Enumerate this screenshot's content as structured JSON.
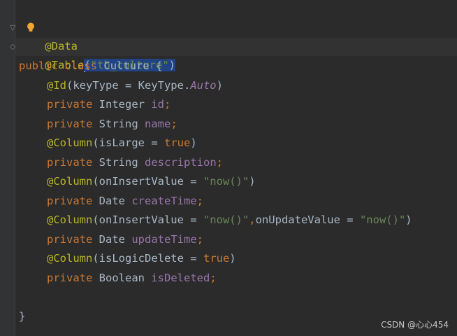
{
  "code": {
    "line1": {
      "ann": "@Data"
    },
    "line2": {
      "ann": "@Table",
      "paren_open": "(",
      "str": "\"tb_culture\"",
      "paren_close": ")"
    },
    "line3": {
      "kw1": "public",
      "kw2": "class",
      "name": "Culture",
      "brace": "{"
    },
    "line4": {
      "ann": "@Id",
      "text": "(keyType = KeyType.",
      "static": "Auto",
      "close": ")"
    },
    "line5": {
      "kw": "private",
      "type": "Integer",
      "field": "id",
      "semi": ";"
    },
    "line6": {
      "kw": "private",
      "type": "String",
      "field": "name",
      "semi": ";"
    },
    "line7": {
      "ann": "@Column",
      "text": "(isLarge = ",
      "kw": "true",
      "close": ")"
    },
    "line8": {
      "kw": "private",
      "type": "String",
      "field": "description",
      "semi": ";"
    },
    "line9": {
      "ann": "@Column",
      "text": "(onInsertValue = ",
      "str": "\"now()\"",
      "close": ")"
    },
    "line10": {
      "kw": "private",
      "type": "Date",
      "field": "createTime",
      "semi": ";"
    },
    "line11": {
      "ann": "@Column",
      "text": "(onInsertValue = ",
      "str": "\"now()\"",
      "comma": ",",
      "text2": "onUpdateValue = ",
      "str2": "\"now()\"",
      "close": ")"
    },
    "line12": {
      "kw": "private",
      "type": "Date",
      "field": "updateTime",
      "semi": ";"
    },
    "line13": {
      "ann": "@Column",
      "text": "(isLogicDelete = ",
      "kw": "true",
      "close": ")"
    },
    "line14": {
      "kw": "private",
      "type": "Boolean",
      "field": "isDeleted",
      "semi": ";"
    },
    "line16": {
      "brace": "}"
    }
  },
  "watermark": "CSDN @心心454",
  "colors": {
    "background": "#2b2b2b",
    "keyword": "#cc7832",
    "annotation": "#bbb529",
    "string": "#6a8759",
    "field": "#9876aa",
    "selection": "#214283"
  }
}
